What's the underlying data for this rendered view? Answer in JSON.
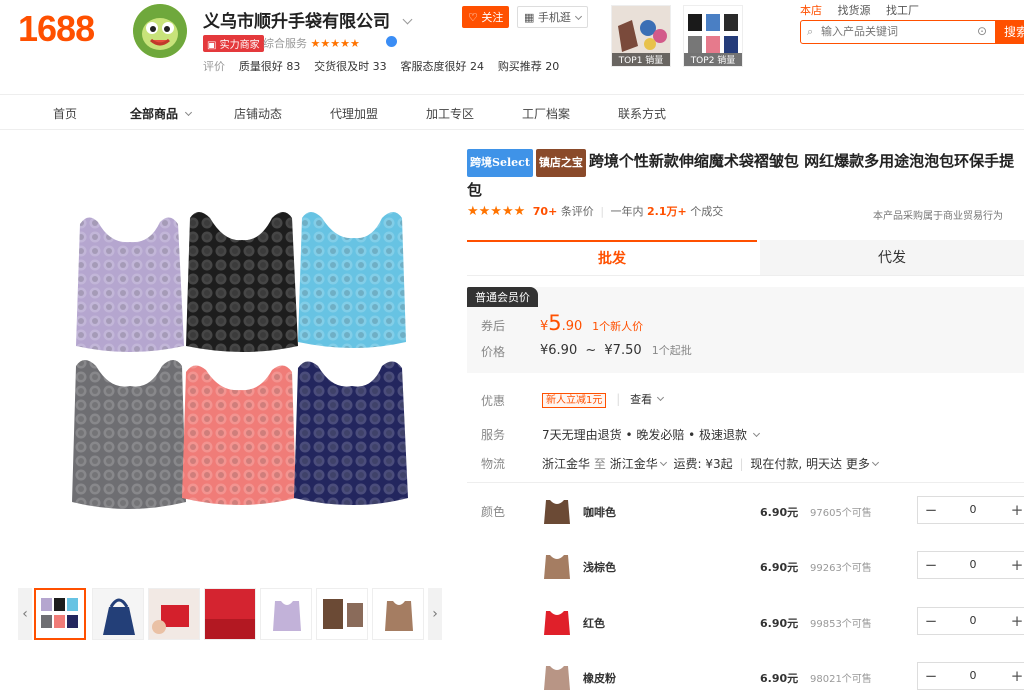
{
  "header": {
    "logo": "1688",
    "shop_name": "义乌市顺升手袋有限公司",
    "strength_badge": "实力商家",
    "overall_label": "综合服务",
    "overall_stars": "★★★★★",
    "follow_label": "关注",
    "mobile_label": "手机逛",
    "eval_label": "评价",
    "evals": [
      "质量很好 83",
      "交货很及时 33",
      "客服态度很好 24",
      "购买推荐 20"
    ],
    "top_items": [
      "TOP1 销量",
      "TOP2 销量"
    ],
    "links": [
      "本店",
      "找货源",
      "找工厂"
    ],
    "search_placeholder": "输入产品关键词",
    "search_button": "搜索"
  },
  "nav": [
    "首页",
    "全部商品",
    "店铺动态",
    "代理加盟",
    "加工专区",
    "工厂档案",
    "联系方式"
  ],
  "product": {
    "tag1": "跨境Select",
    "tag2": "镇店之宝",
    "title": "跨境个性新款伸缩魔术袋褶皱包 网红爆款多用途泡泡包环保手提包",
    "stars": "★★★★★",
    "review_count": "70+",
    "review_label": "条评价",
    "year_label": "一年内",
    "sold_count": "2.1万+",
    "sold_label": "个成交",
    "trade_note": "本产品采购属于商业贸易行为"
  },
  "tabs": [
    "批发",
    "代发"
  ],
  "price": {
    "member_tag": "普通会员价",
    "coupon_label": "券后",
    "coupon_currency": "¥",
    "coupon_int": "5",
    "coupon_dec": ".90",
    "coupon_note": "1个新人价",
    "price_label": "价格",
    "price_range_low": "¥6.90",
    "price_range_sep": "~",
    "price_range_high": "¥7.50",
    "moq": "1个起批"
  },
  "info": {
    "discount_label": "优惠",
    "discount_tag": "新人立减1元",
    "view_label": "查看",
    "service_label": "服务",
    "service_text": "7天无理由退货 • 晚发必赔 • 极速退款",
    "logistics_label": "物流",
    "from": "浙江金华",
    "to_word": "至",
    "to": "浙江金华",
    "freight": "运费: ¥3起",
    "delivery": "现在付款, 明天达",
    "more": "更多"
  },
  "sku": {
    "color_label": "颜色",
    "items": [
      {
        "name": "咖啡色",
        "price": "6.90元",
        "sold": "97605个可售",
        "qty": "0",
        "color": "#6b4a35"
      },
      {
        "name": "浅棕色",
        "price": "6.90元",
        "sold": "99263个可售",
        "qty": "0",
        "color": "#a57d62"
      },
      {
        "name": "红色",
        "price": "6.90元",
        "sold": "99853个可售",
        "qty": "0",
        "color": "#e0202a"
      },
      {
        "name": "橡皮粉",
        "price": "6.90元",
        "sold": "98021个可售",
        "qty": "0",
        "color": "#b89585"
      }
    ]
  },
  "colors": {
    "accent": "#ff5000",
    "lilac": "#b5a6cf",
    "black": "#1d1d1d",
    "sky": "#67c3e3",
    "gray": "#6e6e72",
    "coral": "#f07c78",
    "navy": "#23265e"
  }
}
